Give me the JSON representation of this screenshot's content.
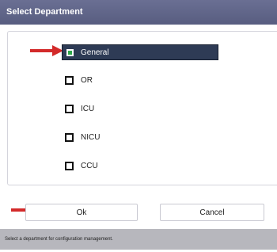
{
  "window": {
    "title": "Select Department"
  },
  "departments": [
    {
      "label": "General",
      "selected": true
    },
    {
      "label": "OR",
      "selected": false
    },
    {
      "label": "ICU",
      "selected": false
    },
    {
      "label": "NICU",
      "selected": false
    },
    {
      "label": "CCU",
      "selected": false
    }
  ],
  "buttons": {
    "ok_label": "Ok",
    "cancel_label": "Cancel"
  },
  "status": {
    "text": "Select a department for configuration management."
  },
  "colors": {
    "titlebar": "#5f6488",
    "selected_bg": "#2e3b55",
    "arrow": "#d32a2a",
    "status_bg": "#b7b7bd"
  },
  "icons": {
    "pointer": "red-arrow-icon"
  }
}
